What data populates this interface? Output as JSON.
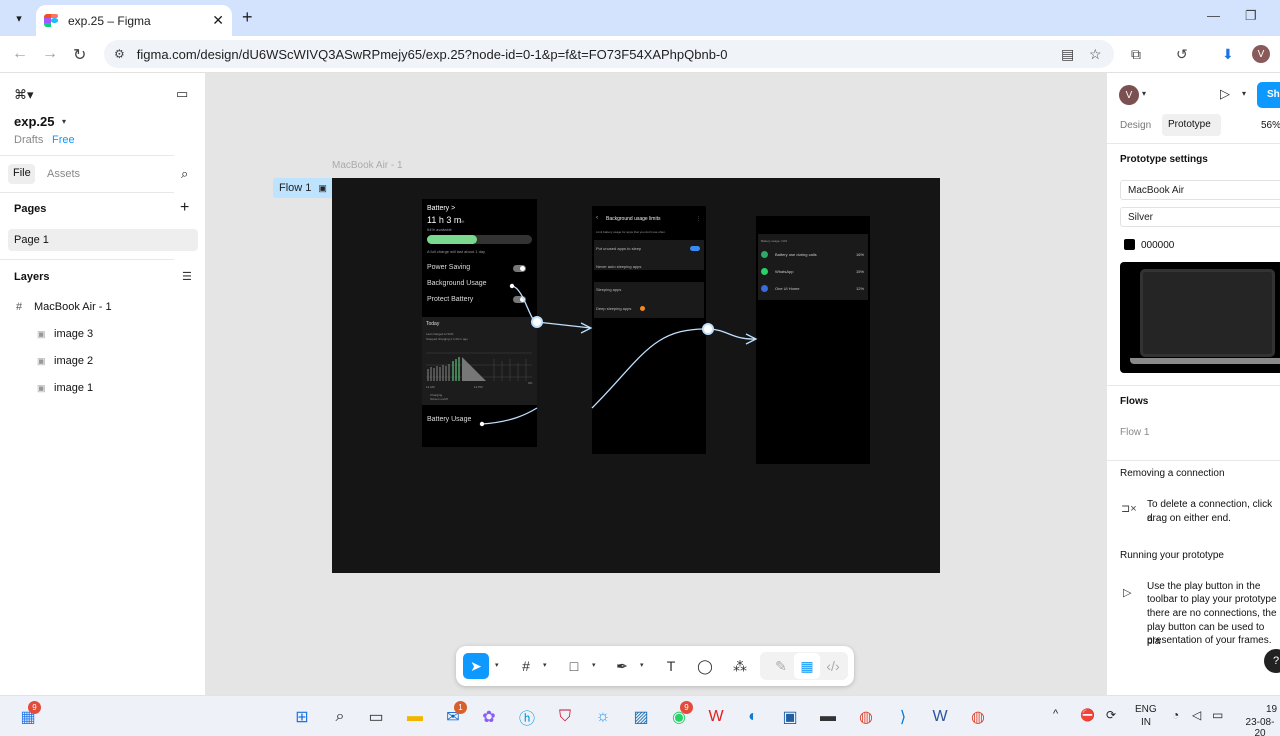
{
  "browser": {
    "tab_title": "exp.25 – Figma",
    "url": "figma.com/design/dU6WScWIVQ3ASwRPmejy65/exp.25?node-id=0-1&p=f&t=FO73F54XAPhpQbnb-0",
    "profile_initial": "V"
  },
  "left_panel": {
    "file_name": "exp.25",
    "drafts_label": "Drafts",
    "plan_label": "Free",
    "tab_file": "File",
    "tab_assets": "Assets",
    "pages_heading": "Pages",
    "pages": [
      "Page 1"
    ],
    "layers_heading": "Layers",
    "layers": [
      {
        "name": "MacBook Air - 1",
        "icon": "frame-icon"
      },
      {
        "name": "image 3",
        "icon": "image-icon"
      },
      {
        "name": "image 2",
        "icon": "image-icon"
      },
      {
        "name": "image 1",
        "icon": "image-icon"
      }
    ]
  },
  "canvas": {
    "frame_label": "MacBook Air - 1",
    "flow_label": "Flow 1",
    "screen1": {
      "title": "Battery >",
      "time_big": "11 h 3 m",
      "time_suffix": "left",
      "pct_small": "64% available",
      "charge_note": "A full charge will last about 1 day",
      "battery_level": 0.48,
      "rows": [
        "Power Saving",
        "Background Usage",
        "Protect Battery"
      ],
      "today_label": "Today",
      "charged_note": "Last charged to 54%",
      "stopped_note": "Stopped charging 1 h 20 m ago",
      "x_left": "12 AM",
      "x_mid": "12 PM",
      "y_right": "0%",
      "legend_1": "Charging",
      "legend_2": "Screen on/off",
      "usage_label": "Battery Usage"
    },
    "screen2": {
      "title": "Background usage limits",
      "subtitle": "Limit battery usage for apps that you don't use often.",
      "row1": "Put unused apps to sleep",
      "row2": "Never auto sleeping apps",
      "row3": "Sleeping apps",
      "row4": "Deep sleeping apps"
    },
    "screen3": {
      "header": "Battery usage: 14%",
      "items": [
        {
          "name": "Battery use during calls",
          "pct": "16%",
          "color": "#2ea96a"
        },
        {
          "name": "WhatsApp",
          "pct": "15%",
          "color": "#25d366"
        },
        {
          "name": "One UI Home",
          "pct": "12%",
          "color": "#3b6bd9"
        }
      ]
    }
  },
  "right_panel": {
    "avatar_initial": "V",
    "share_label": "Sh",
    "tab_design": "Design",
    "tab_prototype": "Prototype",
    "zoom": "56%",
    "prototype_settings": "Prototype settings",
    "device": "MacBook Air",
    "model": "Silver",
    "bg_color_value": "000000",
    "flows_heading": "Flows",
    "flow_name": "Flow 1",
    "removing_heading": "Removing a connection",
    "removing_text_1": "To delete a connection, click a",
    "removing_text_2": "drag on either end.",
    "running_heading": "Running your prototype",
    "running_text_1": "Use the play button in the",
    "running_text_2": "toolbar to play your prototype",
    "running_text_3": "there are no connections, the",
    "running_text_4": "play button can be used to pla",
    "running_text_5": "presentation of your frames.",
    "help_label": "?"
  },
  "taskbar": {
    "widgets_badge": "9",
    "mail_badge": "1",
    "whatsapp_badge": "9",
    "lang_top": "ENG",
    "lang_bottom": "IN",
    "time": "19",
    "date": "23-08-20"
  }
}
